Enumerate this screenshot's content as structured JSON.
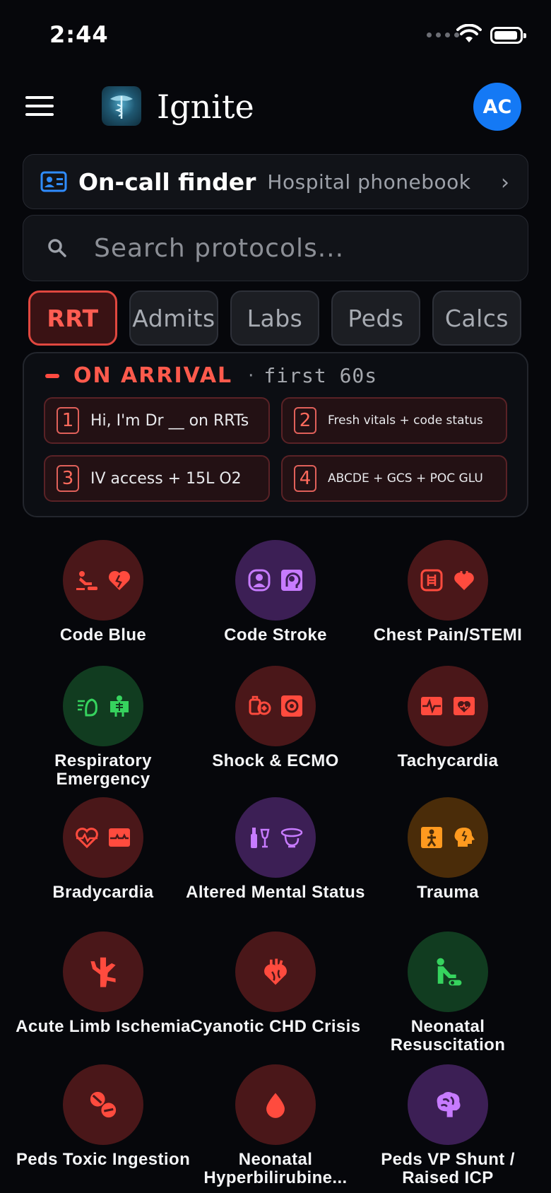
{
  "status_bar": {
    "time": "2:44"
  },
  "header": {
    "app_title": "Ignite",
    "avatar_initials": "AC"
  },
  "oncall": {
    "title": "On-call finder",
    "subtitle": "Hospital phonebook"
  },
  "search": {
    "placeholder": "Search protocols..."
  },
  "tabs": [
    {
      "label": "RRT",
      "active": true
    },
    {
      "label": "Admits",
      "active": false
    },
    {
      "label": "Labs",
      "active": false
    },
    {
      "label": "Peds",
      "active": false
    },
    {
      "label": "Calcs",
      "active": false
    }
  ],
  "arrival": {
    "title": "ON ARRIVAL",
    "separator": "·",
    "subtitle": "first 60s",
    "steps": [
      {
        "num": "1",
        "text": "Hi, I'm Dr __ on RRTs"
      },
      {
        "num": "2",
        "text": "Fresh vitals + code status"
      },
      {
        "num": "3",
        "text": "IV access + 15L O2"
      },
      {
        "num": "4",
        "text": "ABCDE + GCS + POC GLU"
      }
    ]
  },
  "protocols": [
    {
      "label": "Code Blue",
      "color": "red",
      "icons": [
        "cpr-icon",
        "broken-heart-icon"
      ]
    },
    {
      "label": "Code Stroke",
      "color": "purple",
      "icons": [
        "patient-scan-icon",
        "head-brain-icon"
      ]
    },
    {
      "label": "Chest Pain/STEMI",
      "color": "red",
      "icons": [
        "chest-icon",
        "heart-icon"
      ]
    },
    {
      "label": "Respiratory Emergency",
      "color": "green",
      "icons": [
        "lungs-breath-icon",
        "person-xray-icon"
      ]
    },
    {
      "label": "Shock & ECMO",
      "color": "red",
      "icons": [
        "pump-icon",
        "monitor-icon"
      ]
    },
    {
      "label": "Tachycardia",
      "color": "red",
      "icons": [
        "ecg-fast-icon",
        "heart-monitor-icon"
      ]
    },
    {
      "label": "Bradycardia",
      "color": "red",
      "icons": [
        "heartbeat-icon",
        "ecg-slow-icon"
      ]
    },
    {
      "label": "Altered Mental Status",
      "color": "purple",
      "icons": [
        "bottles-icon",
        "head-dizzy-icon"
      ]
    },
    {
      "label": "Trauma",
      "color": "orange",
      "icons": [
        "person-hazard-icon",
        "head-injury-icon"
      ]
    },
    {
      "label": "Acute Limb Ischemia",
      "color": "red",
      "icons": [
        "blood-vessel-icon"
      ]
    },
    {
      "label": "Cyanotic CHD Crisis",
      "color": "red",
      "icons": [
        "anatomical-heart-icon"
      ]
    },
    {
      "label": "Neonatal Resuscitation",
      "color": "green",
      "icons": [
        "infant-cpr-icon"
      ]
    },
    {
      "label": "Peds Toxic Ingestion",
      "color": "red",
      "icons": [
        "pills-icon"
      ]
    },
    {
      "label": "Neonatal Hyperbilirubine...",
      "color": "red",
      "icons": [
        "blood-drop-icon"
      ]
    },
    {
      "label": "Peds VP Shunt / Raised ICP",
      "color": "purple",
      "icons": [
        "brain-icon"
      ]
    }
  ],
  "colors": {
    "accent": "#ff5a4c",
    "avatar": "#1479f5",
    "background": "#06070b"
  }
}
